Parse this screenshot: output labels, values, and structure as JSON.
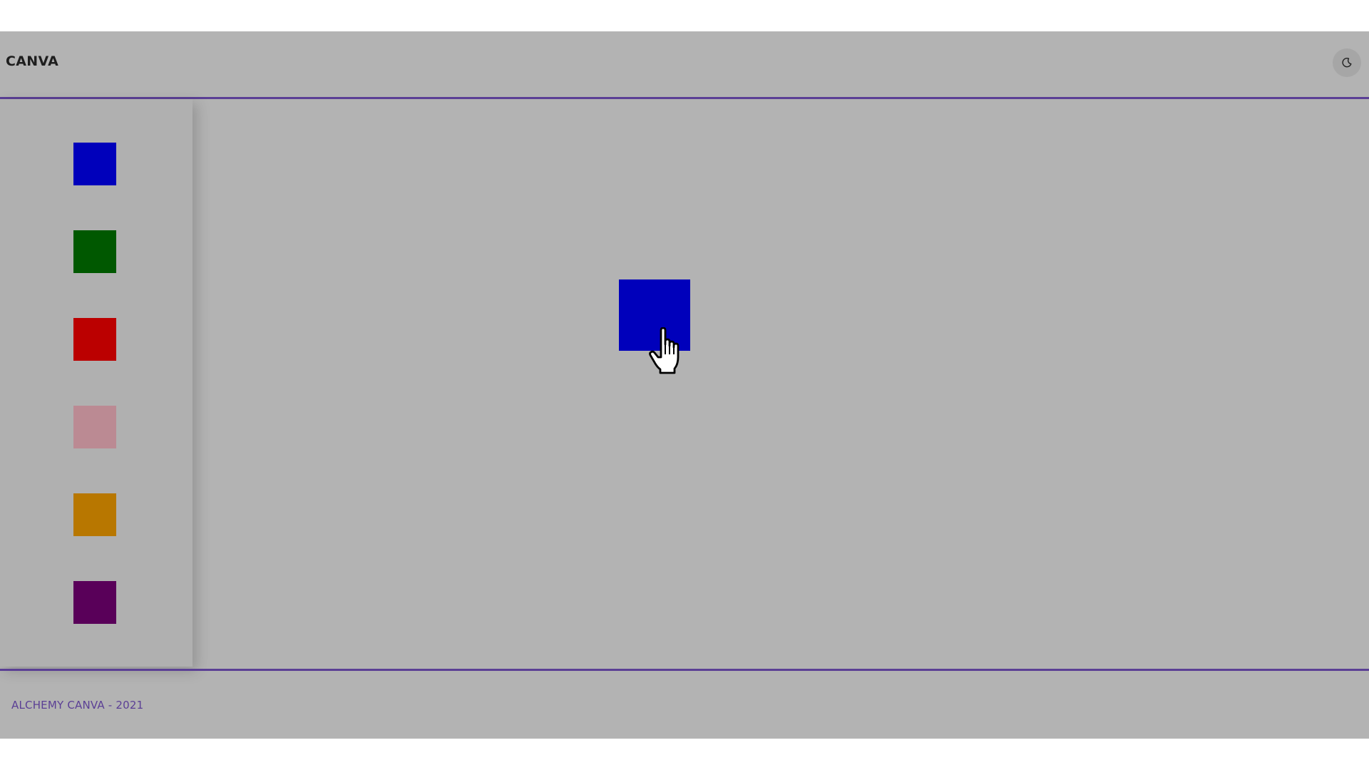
{
  "header": {
    "brand": "CANVA",
    "theme_toggle_icon": "moon-icon"
  },
  "palette": {
    "swatches": [
      {
        "name": "blue",
        "color": "#0000bb"
      },
      {
        "name": "green",
        "color": "#005800"
      },
      {
        "name": "red",
        "color": "#bb0000"
      },
      {
        "name": "pink",
        "color": "#bb8a93"
      },
      {
        "name": "orange",
        "color": "#b87700"
      },
      {
        "name": "purple",
        "color": "#590059"
      }
    ]
  },
  "canvas": {
    "shapes": [
      {
        "color": "#0000bb"
      }
    ]
  },
  "footer": {
    "text": "ALCHEMY CANVA - 2021"
  },
  "colors": {
    "accent": "#5b3f95",
    "background": "#b3b3b3"
  }
}
